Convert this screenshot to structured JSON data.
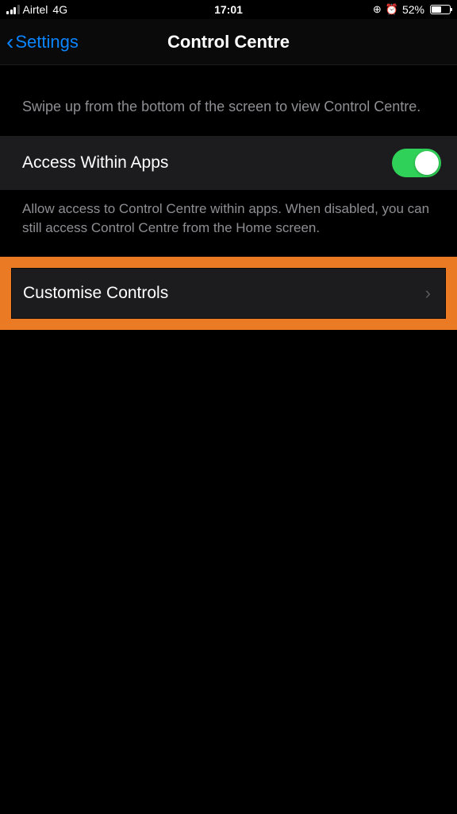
{
  "status_bar": {
    "carrier": "Airtel",
    "network": "4G",
    "time": "17:01",
    "battery_percent": "52%"
  },
  "nav": {
    "back_label": "Settings",
    "title": "Control Centre"
  },
  "intro": {
    "text": "Swipe up from the bottom of the screen to view Control Centre."
  },
  "access_row": {
    "label": "Access Within Apps",
    "footer": "Allow access to Control Centre within apps. When disabled, you can still access Control Centre from the Home screen."
  },
  "customise_row": {
    "label": "Customise Controls"
  }
}
